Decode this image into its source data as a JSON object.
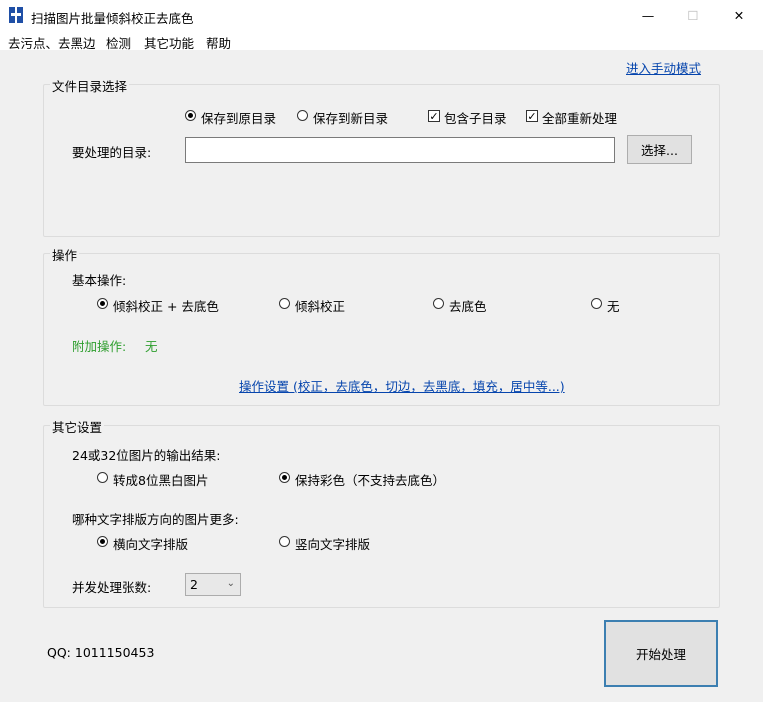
{
  "window": {
    "title": "扫描图片批量倾斜校正去底色",
    "minimize_label": "—",
    "maximize_label": "☐",
    "close_label": "✕"
  },
  "menu": [
    "去污点、去黑边",
    "检测",
    "其它功能",
    "帮助"
  ],
  "manual_mode_link": "进入手动模式",
  "file_dir": {
    "group_title": "文件目录选择",
    "save_original_label": "保存到原目录",
    "save_new_label": "保存到新目录",
    "include_subdirs_label": "包含子目录",
    "reprocess_all_label": "全部重新处理",
    "dir_label": "要处理的目录:",
    "dir_value": "",
    "choose_button": "选择..."
  },
  "operation": {
    "group_title": "操作",
    "basic_label": "基本操作:",
    "options": [
      "倾斜校正 + 去底色",
      "倾斜校正",
      "去底色",
      "无"
    ],
    "extra_label": "附加操作:",
    "extra_value": "无",
    "settings_link": "操作设置 (校正，去底色，切边，去黑底，填充，居中等...)",
    "extra_color": "#2e9e2e"
  },
  "other": {
    "group_title": "其它设置",
    "output_label": "24或32位图片的输出结果:",
    "output_options": [
      "转成8位黑白图片",
      "保持彩色（不支持去底色）"
    ],
    "direction_label": "哪种文字排版方向的图片更多:",
    "direction_options": [
      "横向文字排版",
      "竖向文字排版"
    ],
    "concurrency_label": "并发处理张数:",
    "concurrency_value": "2"
  },
  "footer": {
    "qq_text": "QQ: 1011150453",
    "start_button": "开始处理"
  },
  "colors": {
    "link": "#0645ad",
    "start_border": "#3c7fb1",
    "icon": "#1f4fa6"
  }
}
